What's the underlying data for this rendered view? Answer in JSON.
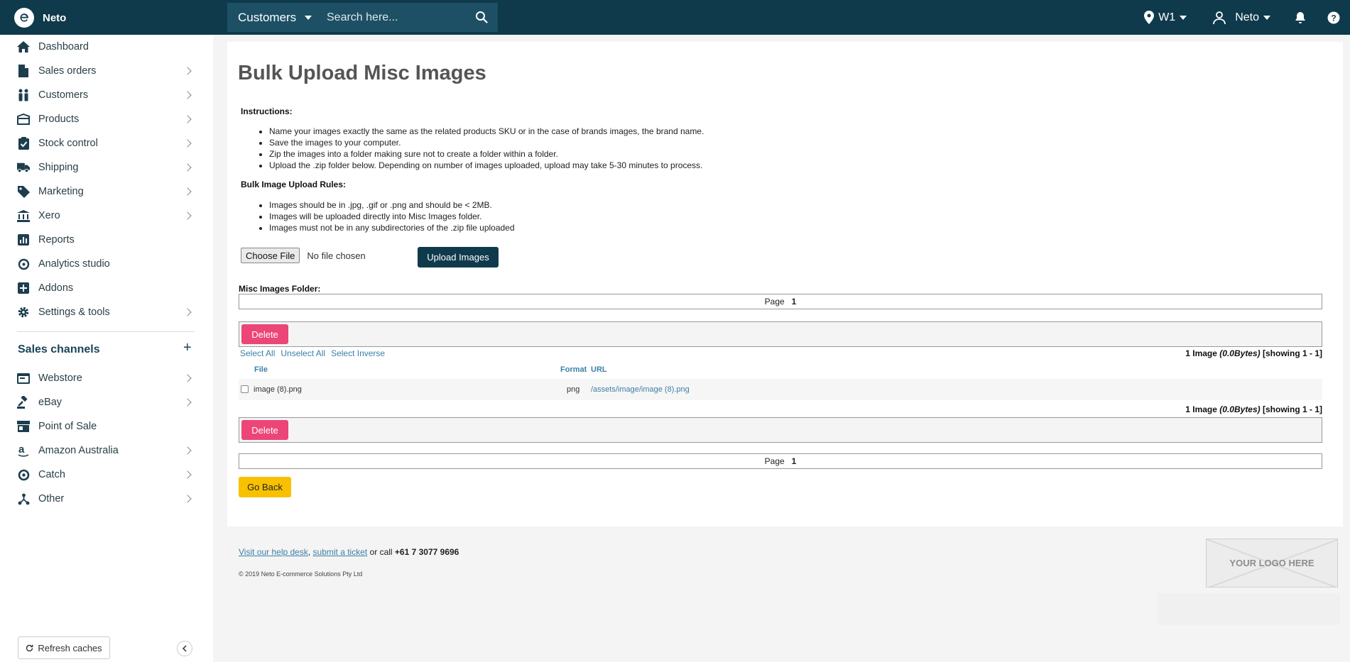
{
  "brand": {
    "name": "Neto"
  },
  "topbar": {
    "search_scope": "Customers",
    "search_placeholder": "Search here...",
    "location": "W1",
    "user": "Neto"
  },
  "sidebar": {
    "items": [
      {
        "label": "Dashboard",
        "icon": "home-icon"
      },
      {
        "label": "Sales orders",
        "icon": "document-icon"
      },
      {
        "label": "Customers",
        "icon": "people-icon"
      },
      {
        "label": "Products",
        "icon": "box-icon"
      },
      {
        "label": "Stock control",
        "icon": "clipboard-check-icon"
      },
      {
        "label": "Shipping",
        "icon": "truck-icon"
      },
      {
        "label": "Marketing",
        "icon": "tag-icon"
      },
      {
        "label": "Xero",
        "icon": "bank-icon"
      },
      {
        "label": "Reports",
        "icon": "bar-chart-icon"
      },
      {
        "label": "Analytics studio",
        "icon": "analytics-icon"
      },
      {
        "label": "Addons",
        "icon": "plus-square-icon"
      },
      {
        "label": "Settings & tools",
        "icon": "gear-icon"
      }
    ],
    "channels_title": "Sales channels",
    "channels": [
      {
        "label": "Webstore",
        "icon": "browser-icon"
      },
      {
        "label": "eBay",
        "icon": "gavel-icon"
      },
      {
        "label": "Point of Sale",
        "icon": "store-icon"
      },
      {
        "label": "Amazon Australia",
        "icon": "amazon-icon"
      },
      {
        "label": "Catch",
        "icon": "catch-icon"
      },
      {
        "label": "Other",
        "icon": "share-icon"
      }
    ],
    "refresh_label": "Refresh caches"
  },
  "main": {
    "title": "Bulk Upload Misc Images",
    "instructions_title": "Instructions:",
    "instructions": [
      "Name your images exactly the same as the related products SKU or in the case of brands images, the brand name.",
      "Save the images to your computer.",
      "Zip the images into a folder making sure not to create a folder within a folder.",
      "Upload the .zip folder below. Depending on number of images uploaded, upload may take 5-30 minutes to process."
    ],
    "rules_title": "Bulk Image Upload Rules:",
    "rules": [
      "Images should be in .jpg, .gif or .png and should be < 2MB.",
      "Images will be uploaded directly into Misc Images folder.",
      "Images must not be in any subdirectories of the .zip file uploaded"
    ],
    "choose_file_label": "Choose File",
    "no_file_label": "No file chosen",
    "upload_label": "Upload Images",
    "folder_label": "Misc Images Folder:",
    "page_label": "Page",
    "page_number": "1",
    "delete_label": "Delete",
    "select_all": "Select All",
    "unselect_all": "Unselect All",
    "select_inverse": "Select Inverse",
    "count_prefix": "1 Image",
    "count_size": "(0.0Bytes)",
    "count_showing": "[showing 1 - 1]",
    "columns": {
      "file": "File",
      "format": "Format",
      "url": "URL"
    },
    "rows": [
      {
        "file": "image (8).png",
        "format": "png",
        "url": "/assets/image/image (8).png"
      }
    ],
    "go_back_label": "Go Back"
  },
  "footer": {
    "help_link": "Visit our help desk",
    "ticket_link": "submit a ticket",
    "call_text": "or call",
    "phone": "+61 7 3077 9696",
    "copyright": "© 2019 Neto E-commerce Solutions Pty Ltd",
    "logo_placeholder": "YOUR LOGO HERE"
  }
}
